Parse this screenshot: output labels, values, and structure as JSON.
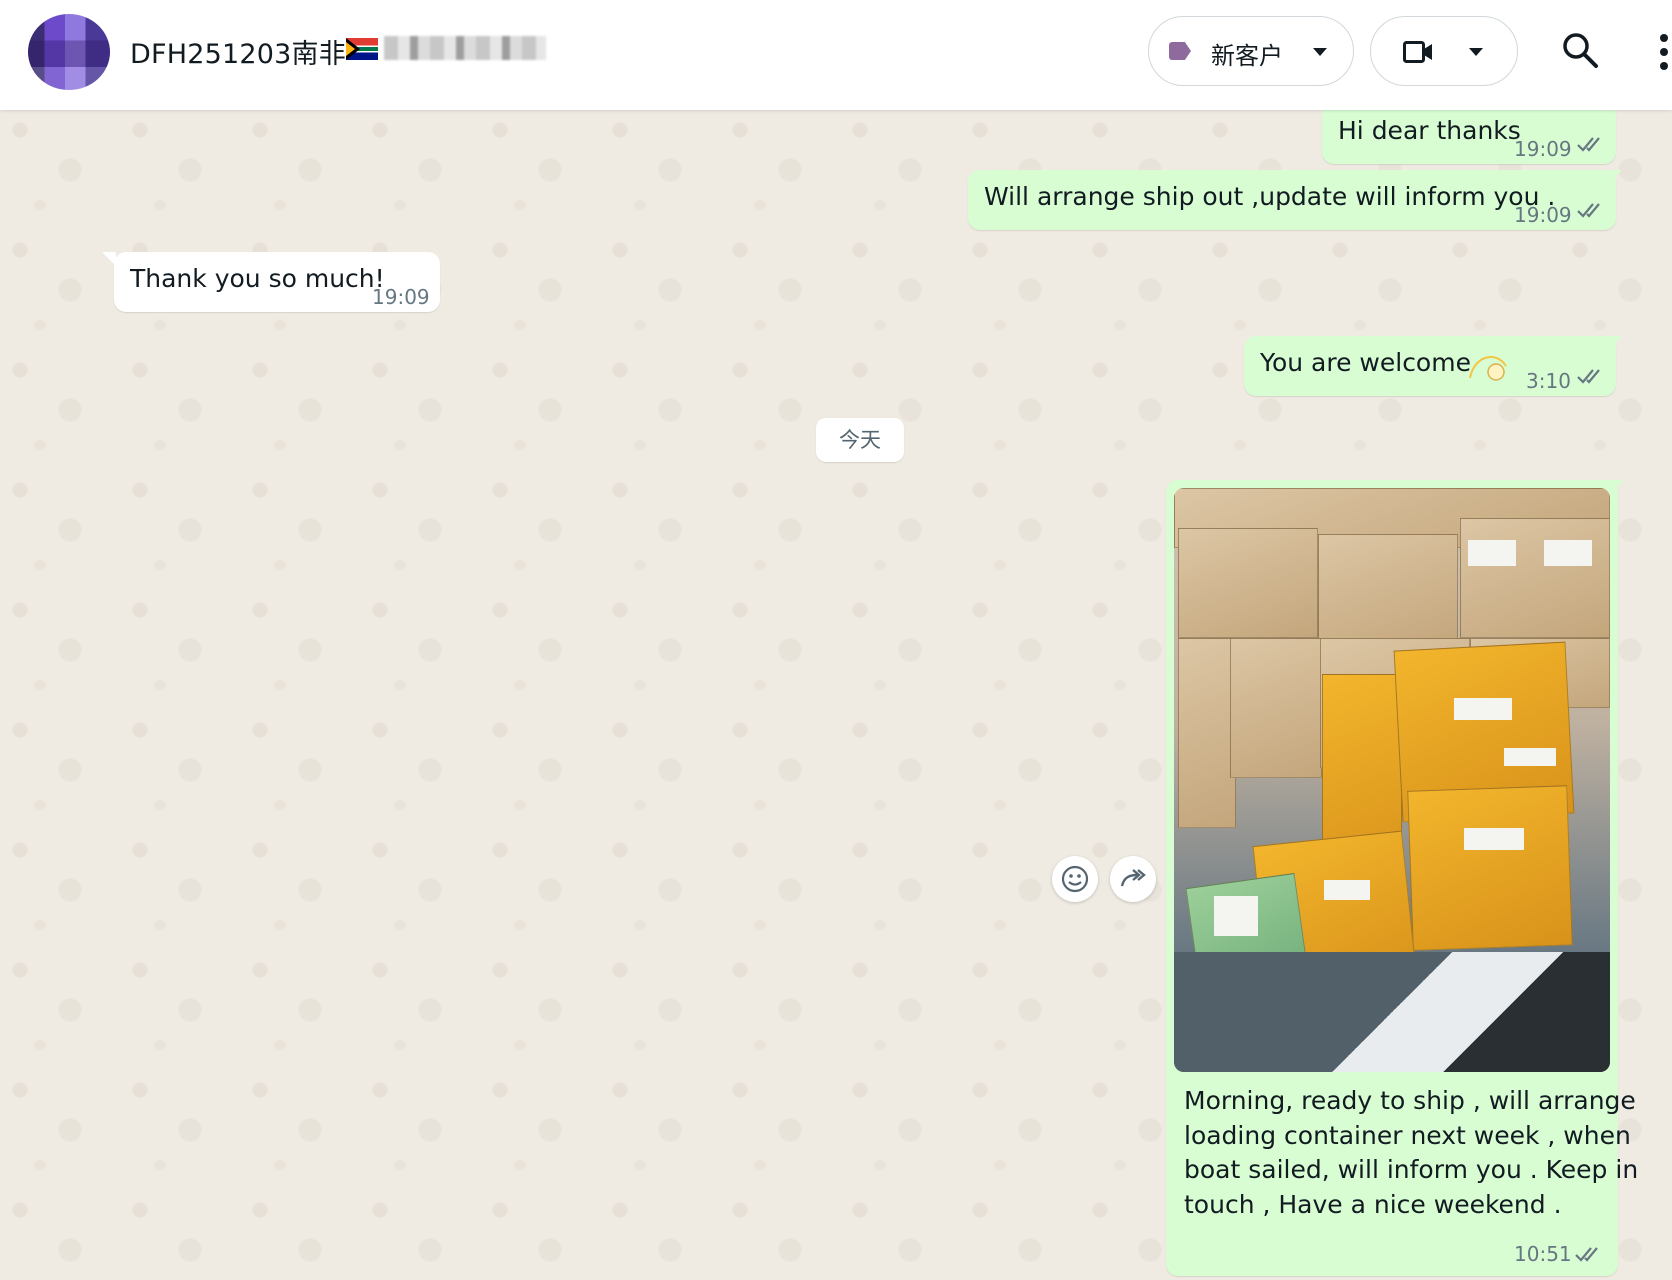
{
  "header": {
    "contact_name": "DFH251203南非",
    "tag_label": "新客户",
    "colors": {
      "tag": "#8e6b9c"
    }
  },
  "icons": {
    "tag": "label-tag-icon",
    "tag_dropdown": "chevron-down-icon",
    "video": "video-call-icon",
    "video_dropdown": "chevron-down-icon",
    "search": "search-icon",
    "menu": "more-vertical-icon",
    "read_receipt": "double-check-icon",
    "emoji_react": "emoji-icon",
    "forward": "forward-icon",
    "flag": "south-africa-flag-icon"
  },
  "messages": [
    {
      "direction": "out",
      "text": "Hi dear thanks",
      "time": "19:09"
    },
    {
      "direction": "out",
      "text": "Will arrange ship out ,update will inform you .",
      "time": "19:09"
    },
    {
      "direction": "in",
      "text": "Thank you so much!",
      "time": "19:09"
    },
    {
      "direction": "out",
      "text": "You are welcome",
      "time": "3:10"
    },
    {
      "direction": "out",
      "type": "image",
      "caption_lines": [
        "Morning, ready to ship , will arrange",
        "loading container next week , when",
        "boat sailed, will inform you . Keep in",
        "touch , Have a nice weekend ."
      ],
      "time": "10:51"
    }
  ],
  "date_divider": "今天",
  "colors": {
    "outgoing_bubble": "#d9fdd3",
    "incoming_bubble": "#ffffff",
    "wallpaper": "#efeae2",
    "ticks": "#667781"
  }
}
